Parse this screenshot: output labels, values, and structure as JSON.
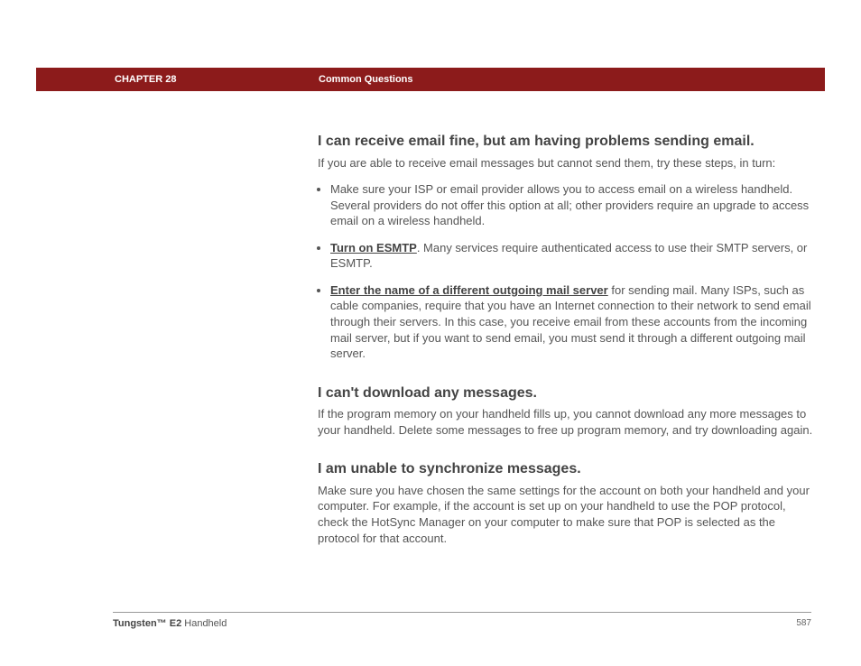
{
  "header": {
    "chapter": "CHAPTER 28",
    "title": "Common Questions"
  },
  "sections": {
    "s1": {
      "heading": "I can receive email fine, but am having problems sending email.",
      "intro": "If you are able to receive email messages but cannot send them, try these steps, in turn:",
      "bullet1": "Make sure your ISP or email provider allows you to access email on a wireless handheld. Several providers do not offer this option at all; other providers require an upgrade to access email on a wireless handheld.",
      "bullet2_link": "Turn on ESMTP",
      "bullet2_rest": ". Many services require authenticated access to use their SMTP servers, or ESMTP.",
      "bullet3_link": "Enter the name of a different outgoing mail server",
      "bullet3_rest": " for sending mail. Many ISPs, such as cable companies, require that you have an Internet connection to their network to send email through their servers. In this case, you receive email from these accounts from the incoming mail server, but if you want to send email, you must send it through a different outgoing mail server."
    },
    "s2": {
      "heading": "I can't download any messages.",
      "body": "If the program memory on your handheld fills up, you cannot download any more messages to your handheld. Delete some messages to free up program memory, and try downloading again."
    },
    "s3": {
      "heading": "I am unable to synchronize messages.",
      "body": "Make sure you have chosen the same settings for the account on both your handheld and your computer. For example, if the account is set up on your handheld to use the POP protocol, check the HotSync Manager on your computer to make sure that POP is selected as the protocol for that account."
    }
  },
  "footer": {
    "product_bold": "Tungsten™ E2",
    "product_rest": " Handheld",
    "page": "587"
  }
}
